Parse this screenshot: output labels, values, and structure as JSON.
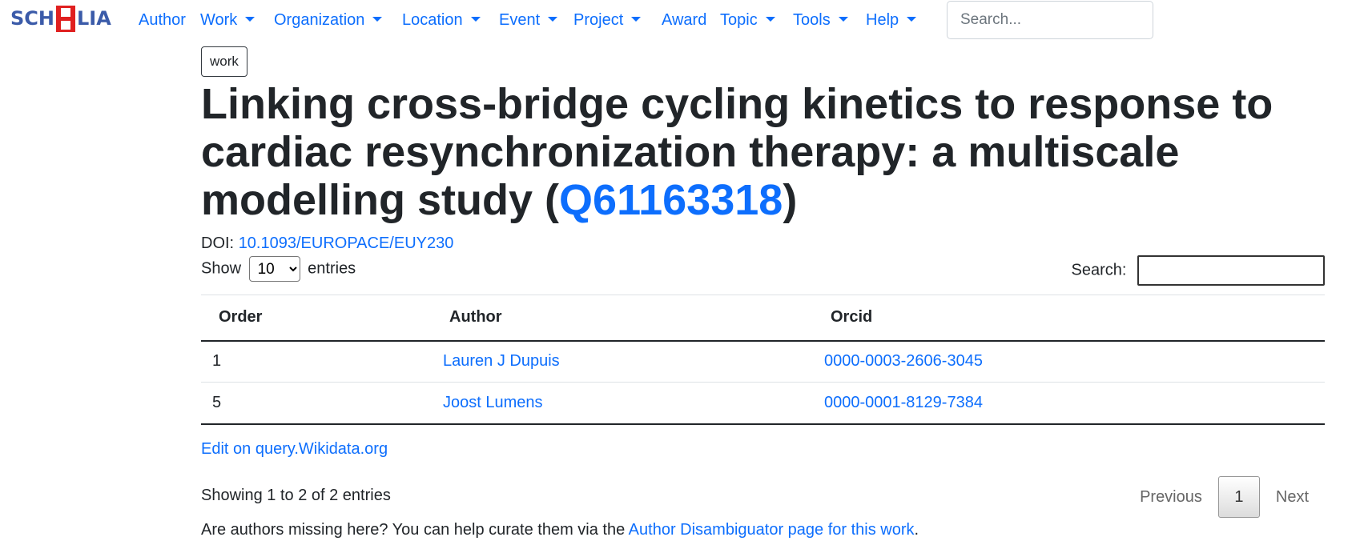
{
  "navbar": {
    "logo_text": "SCHOLIA",
    "items": [
      {
        "label": "Author",
        "dropdown": false
      },
      {
        "label": "Work",
        "dropdown": true
      },
      {
        "label": "Organization",
        "dropdown": true
      },
      {
        "label": "Location",
        "dropdown": true
      },
      {
        "label": "Event",
        "dropdown": true
      },
      {
        "label": "Project",
        "dropdown": true
      },
      {
        "label": "Award",
        "dropdown": false
      },
      {
        "label": "Topic",
        "dropdown": true
      },
      {
        "label": "Tools",
        "dropdown": true
      },
      {
        "label": "Help",
        "dropdown": true
      }
    ],
    "search_placeholder": "Search..."
  },
  "page": {
    "badge": "work",
    "title": "Linking cross-bridge cycling kinetics to response to cardiac resynchronization therapy: a multiscale modelling study",
    "title_open": "(",
    "qid": "Q61163318",
    "title_close": ")",
    "doi_label": "DOI:",
    "doi": "10.1093/EUROPACE/EUY230"
  },
  "table": {
    "show_label": "Show",
    "entries_label": "entries",
    "page_size": "10",
    "search_label": "Search:",
    "columns": [
      "Order",
      "Author",
      "Orcid"
    ],
    "rows": [
      {
        "order": "1",
        "author": "Lauren J Dupuis",
        "orcid": "0000-0003-2606-3045"
      },
      {
        "order": "5",
        "author": "Joost Lumens",
        "orcid": "0000-0001-8129-7384"
      }
    ],
    "edit_link": "Edit on query.Wikidata.org",
    "info": "Showing 1 to 2 of 2 entries",
    "pagination": {
      "previous": "Previous",
      "current": "1",
      "next": "Next"
    }
  },
  "footer_note": {
    "text": "Are authors missing here? You can help curate them via the ",
    "link": "Author Disambiguator page for this work",
    "end": "."
  },
  "colors": {
    "link": "#0d6efd",
    "logo_blue": "#3b5ba9",
    "logo_red": "#e02020"
  }
}
